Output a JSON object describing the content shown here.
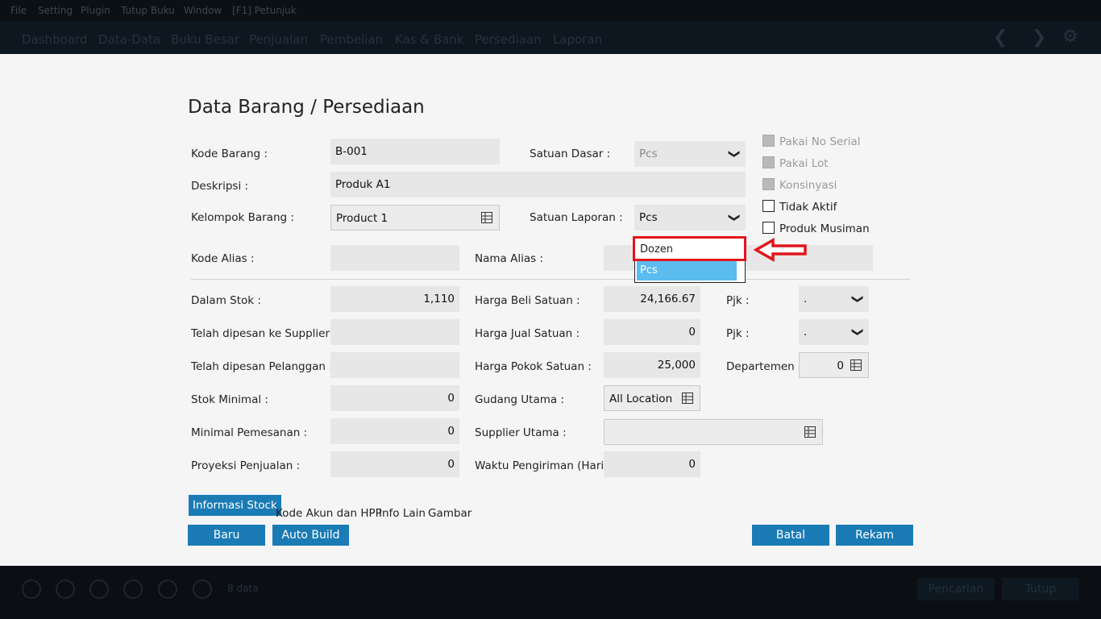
{
  "menu": [
    "File",
    "Setting",
    "Plugin",
    "Tutup Buku",
    "Window",
    "[F1] Petunjuk"
  ],
  "nav": [
    "Dashboard",
    "Data-Data",
    "Buku Besar",
    "Penjualan",
    "Pembelian",
    "Kas & Bank",
    "Persediaan",
    "Laporan"
  ],
  "nav_arrows": {
    "prev": "❮",
    "next": "❯",
    "gear": "⚙"
  },
  "form": {
    "title": "Data Barang / Persediaan",
    "kode_barang": {
      "label": "Kode Barang :",
      "value": "B-001"
    },
    "deskripsi": {
      "label": "Deskripsi :",
      "value": "Produk A1"
    },
    "kelompok_barang": {
      "label": "Kelompok Barang :",
      "value": "Product 1"
    },
    "satuan_dasar": {
      "label": "Satuan Dasar :",
      "value": "Pcs"
    },
    "satuan_laporan": {
      "label": "Satuan Laporan :",
      "value": "Pcs"
    },
    "kode_alias": {
      "label": "Kode Alias :",
      "value": ""
    },
    "nama_alias": {
      "label": "Nama Alias :",
      "value": ""
    },
    "dropdown_options": [
      "Dozen",
      "Pcs"
    ],
    "checkboxes": [
      {
        "label": "Pakai No Serial",
        "disabled": true
      },
      {
        "label": "Pakai Lot",
        "disabled": true
      },
      {
        "label": "Konsinyasi",
        "disabled": true
      },
      {
        "label": "Tidak Aktif",
        "disabled": false
      },
      {
        "label": "Produk Musiman",
        "disabled": false
      }
    ],
    "dalam_stok": {
      "label": "Dalam Stok :",
      "value": "1,110"
    },
    "dipesan_supplier": {
      "label": "Telah dipesan ke Supplier :",
      "value": ""
    },
    "dipesan_pelanggan": {
      "label": "Telah dipesan Pelanggan :",
      "value": ""
    },
    "stok_minimal": {
      "label": "Stok Minimal :",
      "value": "0"
    },
    "minimal_pemesanan": {
      "label": "Minimal Pemesanan :",
      "value": "0"
    },
    "proyeksi_penjualan": {
      "label": "Proyeksi Penjualan :",
      "value": "0"
    },
    "harga_beli": {
      "label": "Harga Beli Satuan :",
      "value": "24,166.67"
    },
    "harga_jual": {
      "label": "Harga Jual Satuan :",
      "value": "0"
    },
    "harga_pokok": {
      "label": "Harga Pokok Satuan :",
      "value": "25,000"
    },
    "gudang_utama": {
      "label": "Gudang Utama :",
      "value": "All Location"
    },
    "supplier_utama": {
      "label": "Supplier Utama :",
      "value": ""
    },
    "waktu_pengiriman": {
      "label": "Waktu Pengiriman (Hari) :",
      "value": "0"
    },
    "pjk1": {
      "label": "Pjk :",
      "value": "."
    },
    "pjk2": {
      "label": "Pjk :",
      "value": "."
    },
    "departemen": {
      "label": "Departemen :",
      "value": "0"
    }
  },
  "tabs": [
    "Informasi Stock",
    "Kode Akun dan HPP",
    "Info Lain",
    "Gambar"
  ],
  "buttons": {
    "baru": "Baru",
    "auto_build": "Auto Build",
    "batal": "Batal",
    "rekam": "Rekam"
  },
  "bottom": {
    "count": "8 data",
    "pencarian": "Pencarian",
    "tutup": "Tutup"
  },
  "colors": {
    "accent": "#1a7bb5",
    "dropdown_selected": "#5bbcf0",
    "annotation": "#e3141b"
  }
}
